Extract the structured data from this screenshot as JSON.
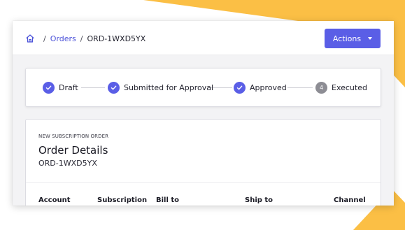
{
  "breadcrumb": {
    "home_icon": "home-icon",
    "separator": "/",
    "orders_label": "Orders",
    "current_label": "ORD-1WXD5YX"
  },
  "toolbar": {
    "actions_label": "Actions",
    "actions_icon": "chevron-down-icon"
  },
  "stepper": {
    "steps": [
      {
        "label": "Draft",
        "state": "completed"
      },
      {
        "label": "Submitted for Approval",
        "state": "completed"
      },
      {
        "label": "Approved",
        "state": "completed"
      },
      {
        "label": "Executed",
        "state": "pending",
        "number": "4"
      }
    ]
  },
  "details": {
    "kicker": "NEW SUBSCRIPTION ORDER",
    "title": "Order Details",
    "order_id": "ORD-1WXD5YX",
    "columns": [
      "Account",
      "Subscription",
      "Bill to",
      "Ship to",
      "Channel"
    ]
  },
  "colors": {
    "accent": "#5a5ee6",
    "link": "#4b52d9",
    "pending_step": "#8d8d94",
    "background_shape": "#fbbf45"
  }
}
